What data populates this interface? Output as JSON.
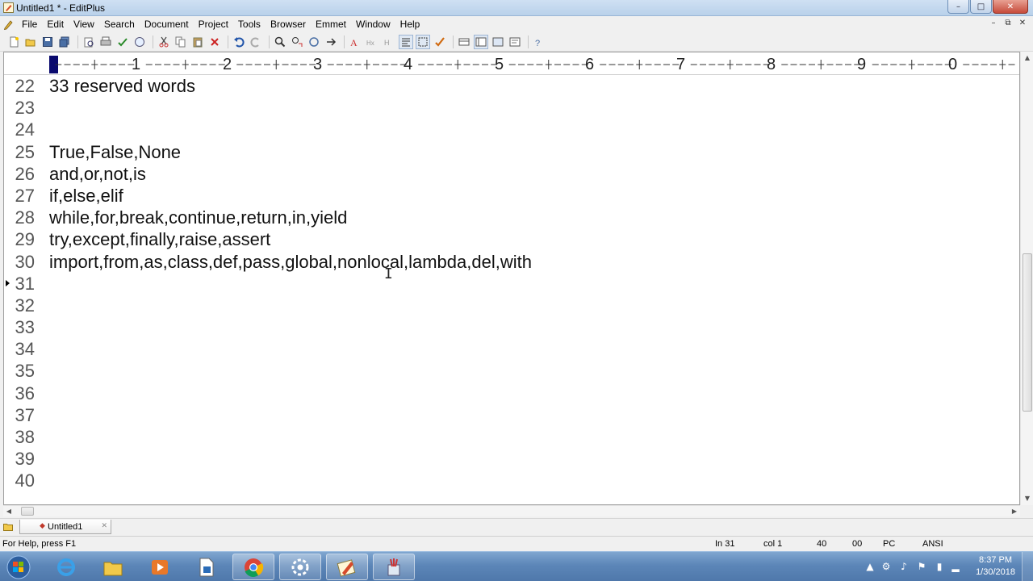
{
  "window": {
    "title": "Untitled1 * - EditPlus",
    "minimize_glyph": "–",
    "maximize_glyph": "□",
    "close_glyph": "✕"
  },
  "menu": {
    "items": [
      "File",
      "Edit",
      "View",
      "Search",
      "Document",
      "Project",
      "Tools",
      "Browser",
      "Emmet",
      "Window",
      "Help"
    ],
    "mdi_minimize": "–",
    "mdi_restore": "⧉",
    "mdi_close": "✕"
  },
  "toolbar": {
    "buttons": [
      "new-file",
      "open-file",
      "save",
      "save-all",
      "print-preview",
      "print",
      "spell-check",
      "browser-preview",
      "cut",
      "copy",
      "paste",
      "delete",
      "undo",
      "redo",
      "find",
      "replace",
      "find-in-files",
      "goto",
      "font",
      "hex",
      "hide",
      "word-wrap",
      "column-select",
      "check",
      "ruler",
      "line-numbers",
      "full-screen",
      "cliptext",
      "help"
    ]
  },
  "ruler": {
    "labels": [
      "1",
      "2",
      "3",
      "4",
      "5",
      "6",
      "7",
      "8",
      "9",
      "0"
    ]
  },
  "editor": {
    "lines": [
      {
        "num": "22",
        "text": "33 reserved words"
      },
      {
        "num": "23",
        "text": ""
      },
      {
        "num": "24",
        "text": ""
      },
      {
        "num": "25",
        "text": "True,False,None"
      },
      {
        "num": "26",
        "text": "and,or,not,is"
      },
      {
        "num": "27",
        "text": "if,else,elif"
      },
      {
        "num": "28",
        "text": "while,for,break,continue,return,in,yield"
      },
      {
        "num": "29",
        "text": "try,except,finally,raise,assert"
      },
      {
        "num": "30",
        "text": "import,from,as,class,def,pass,global,nonlocal,lambda,del,with"
      },
      {
        "num": "31",
        "text": ""
      },
      {
        "num": "32",
        "text": ""
      },
      {
        "num": "33",
        "text": ""
      },
      {
        "num": "34",
        "text": ""
      },
      {
        "num": "35",
        "text": ""
      },
      {
        "num": "36",
        "text": ""
      },
      {
        "num": "37",
        "text": ""
      },
      {
        "num": "38",
        "text": ""
      },
      {
        "num": "39",
        "text": ""
      },
      {
        "num": "40",
        "text": ""
      }
    ],
    "current_line": "31"
  },
  "doc_tabs": {
    "active": "Untitled1"
  },
  "status": {
    "help": "For Help, press F1",
    "line": "In 31",
    "col": "col 1",
    "value_40": "40",
    "value_00": "00",
    "mode": "PC",
    "encoding": "ANSI"
  },
  "taskbar": {
    "apps": [
      "internet-explorer",
      "file-explorer",
      "media-player",
      "document-app",
      "chrome",
      "settings-app",
      "editplus",
      "paint-app"
    ],
    "clock_time": "8:37 PM",
    "clock_date": "1/30/2018"
  },
  "colors": {
    "title_gradient": "#b9d1ea",
    "editor_bg": "#ffffff",
    "taskbar": "#5c86b8"
  }
}
